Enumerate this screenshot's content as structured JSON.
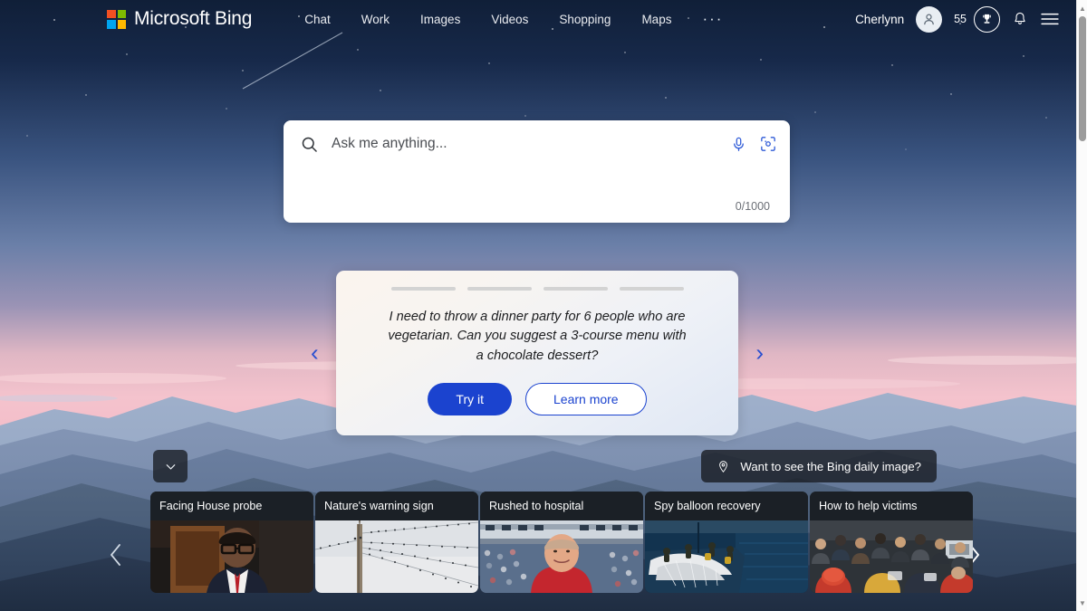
{
  "header": {
    "brand": "Microsoft Bing",
    "logo_colors": [
      "#f25022",
      "#7fba00",
      "#00a4ef",
      "#ffb900"
    ],
    "nav": [
      {
        "label": "Chat",
        "name": "nav-chat"
      },
      {
        "label": "Work",
        "name": "nav-work"
      },
      {
        "label": "Images",
        "name": "nav-images"
      },
      {
        "label": "Videos",
        "name": "nav-videos"
      },
      {
        "label": "Shopping",
        "name": "nav-shopping"
      },
      {
        "label": "Maps",
        "name": "nav-maps"
      }
    ],
    "overflow_label": "···",
    "user_name": "Cherlynn",
    "rewards_count": "55",
    "icons": {
      "avatar": "person-icon",
      "rewards": "trophy-icon",
      "notifications": "bell-icon",
      "menu": "hamburger-menu-icon"
    }
  },
  "search": {
    "placeholder": "Ask me anything...",
    "value": "",
    "counter": "0/1000",
    "icons": {
      "search": "search-icon",
      "mic": "microphone-icon",
      "visual": "visual-search-icon"
    }
  },
  "suggestion": {
    "text": "I need to throw a dinner party for 6 people who are vegetarian. Can you suggest a 3-course menu with a chocolate dessert?",
    "try_label": "Try it",
    "learn_label": "Learn more",
    "prev_label": "‹",
    "next_label": "›",
    "progress": {
      "total": 4,
      "active_index": 0,
      "active_fill_percent": 70
    },
    "accent_color": "#1b43cf"
  },
  "peek": {
    "chevron_label": "chevron-down-icon",
    "daily_image_label": "Want to see the Bing daily image?",
    "pin_icon": "location-pin-icon"
  },
  "carousel": {
    "prev_label": "‹",
    "next_label": "›",
    "cards": [
      {
        "title": "Facing House probe",
        "scene": "politician"
      },
      {
        "title": "Nature's warning sign",
        "scene": "birds"
      },
      {
        "title": "Rushed to hospital",
        "scene": "stadium"
      },
      {
        "title": "Spy balloon recovery",
        "scene": "sea"
      },
      {
        "title": "How to help victims",
        "scene": "crowd"
      }
    ]
  },
  "scrollbar": {
    "up_label": "▲",
    "down_label": "▼"
  }
}
